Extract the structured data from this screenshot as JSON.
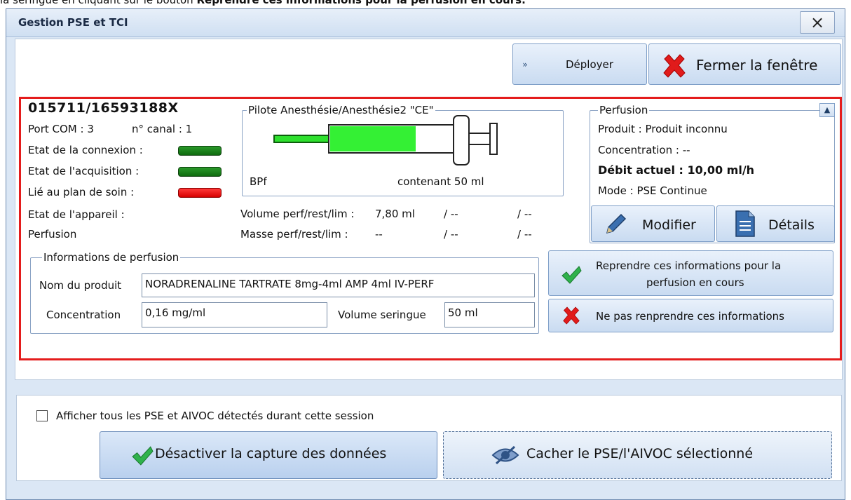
{
  "caption": {
    "prefix": "la seringue en cliquant sur le bouton ",
    "bold": "Reprendre ces informations pour la perfusion en cours."
  },
  "window": {
    "title": "Gestion PSE et TCI",
    "close_label": "×"
  },
  "toolbar": {
    "deployer_label": "Déployer",
    "fermer_label": "Fermer la fenêtre"
  },
  "pump": {
    "id": "015711/16593188X",
    "port_com": "Port COM : 3",
    "canal": "n° canal : 1",
    "etat_connexion": "Etat de la connexion :",
    "etat_acquisition": "Etat de l'acquisition :",
    "lie_plan": "Lié au plan de soin :",
    "etat_appareil": "Etat de l'appareil :",
    "perfusion": "Perfusion",
    "status_colors": {
      "connexion": "#1a8a1a",
      "acquisition": "#1a8a1a",
      "plan": "#ff1a1a"
    }
  },
  "syringe": {
    "legend": "Pilote Anesthésie/Anesthésie2 \"CE\"",
    "drug_code": "BPf",
    "contenant": "contenant 50 ml",
    "fill_fraction": 0.62
  },
  "volumes": {
    "volume_label": "Volume perf/rest/lim :",
    "volume_value": "7,80 ml",
    "volume_rest": "/ --",
    "volume_lim": "/ --",
    "masse_label": "Masse perf/rest/lim :",
    "masse_value": "--",
    "masse_rest": "/ --",
    "masse_lim": "/ --"
  },
  "perfusion_panel": {
    "legend": "Perfusion",
    "produit": "Produit :  Produit inconnu",
    "concentration": "Concentration : --",
    "debit": "Débit actuel :  10,00 ml/h",
    "mode": "Mode :  PSE Continue",
    "modifier_label": "Modifier",
    "details_label": "Détails"
  },
  "info_perfusion": {
    "legend": "Informations de perfusion",
    "nom_label": "Nom du produit",
    "nom_value": "NORADRENALINE TARTRATE 8mg-4ml AMP 4ml IV-PERF",
    "concentration_label": "Concentration",
    "concentration_value": "0,16 mg/ml",
    "volume_label": "Volume seringue",
    "volume_value": "50 ml"
  },
  "actions": {
    "reprendre_line1": "Reprendre ces informations pour la",
    "reprendre_line2": "perfusion en cours",
    "nepas_label": "Ne pas renprendre ces informations"
  },
  "bottom": {
    "checkbox_label": "Afficher tous les PSE et AIVOC détectés durant cette session",
    "checkbox_checked": false,
    "desactiver_label": "Désactiver la capture des données",
    "cacher_label": "Cacher le PSE/l'AIVOC sélectionné"
  }
}
